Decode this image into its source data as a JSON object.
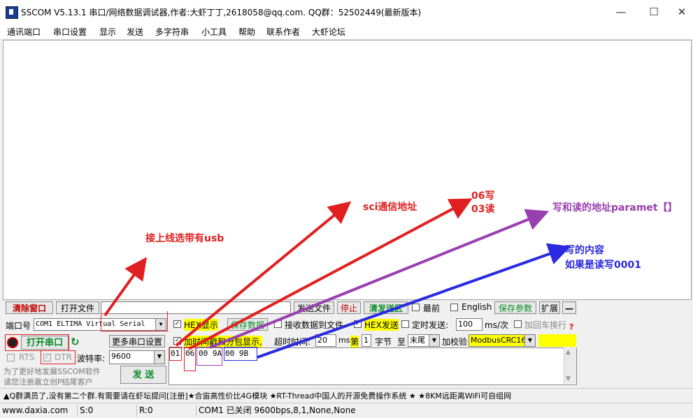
{
  "window": {
    "title": "SSCOM V5.13.1 串口/网络数据调试器,作者:大虾丁丁,2618058@qq.com. QQ群：52502449(最新版本)",
    "minimize": "—",
    "maximize": "☐",
    "close": "✕"
  },
  "menu": [
    "通讯端口",
    "串口设置",
    "显示",
    "发送",
    "多字符串",
    "小工具",
    "帮助",
    "联系作者",
    "大虾论坛"
  ],
  "toolbar1": {
    "clear_window": "清除窗口",
    "open_file": "打开文件",
    "send_file": "发送文件",
    "stop": "停止",
    "clear_send": "清发送区",
    "topmost": "最前",
    "english": "English",
    "save_params": "保存参数",
    "expand": "扩展",
    "collapse": "—"
  },
  "port": {
    "label": "端口号",
    "value": "COM1 ELTIMA Virtual Serial",
    "hex_display": "HEX显示",
    "save_data": "保存数据",
    "recv_to_file": "接收数据到文件",
    "hex_send": "HEX发送",
    "timed_send": "定时发送:",
    "interval": "100",
    "interval_unit": "ms/次",
    "add_crlf": "加回车换行"
  },
  "open": {
    "open_port": "打开串口",
    "more_settings": "更多串口设置",
    "add_timestamp": "加时间戳和分包显示,",
    "timeout_label": "超时时间:",
    "timeout_value": "20",
    "timeout_unit": "ms",
    "nth": "第",
    "byte_from": "1",
    "byte_label": "字节",
    "to": "至",
    "end": "末尾",
    "checksum_label": "加校验",
    "checksum": "ModbusCRC16"
  },
  "baud": {
    "rts": "RTS",
    "dtr": "DTR",
    "label": "波特率:",
    "value": "9600"
  },
  "send_fields": [
    "01",
    "06",
    "00 9A",
    "00 9B"
  ],
  "promo": {
    "line1": "为了更好地发展SSCOM软件",
    "line2": "请您注册嘉立创P结尾客户",
    "send_button": "发  送"
  },
  "ticker": "▲Q群满员了,没有第二个群.有需要请在虾坛提问[注册]★合宙高性价比4G模块 ★RT-Thread中国人的开源免费操作系统 ★ ★8KM远距离WiFi可自组网",
  "status": {
    "website": "www.daxia.com",
    "s": "S:0",
    "r": "R:0",
    "state": "COM1 已关闭  9600bps,8,1,None,None"
  },
  "annotations": {
    "usb": "接上线选带有usb",
    "sci": "sci通信地址",
    "func_line1": "06写",
    "func_line2": "03读",
    "addr": "写和读的地址paramet【】",
    "content_line1": "写的内容",
    "content_line2": "如果是读写0001"
  },
  "colors": {
    "red": "#e02020",
    "purple": "#9a3fb0",
    "blue": "#2a2ae0",
    "green_text": "#0b8a2a",
    "highlight": "#ffff00"
  }
}
